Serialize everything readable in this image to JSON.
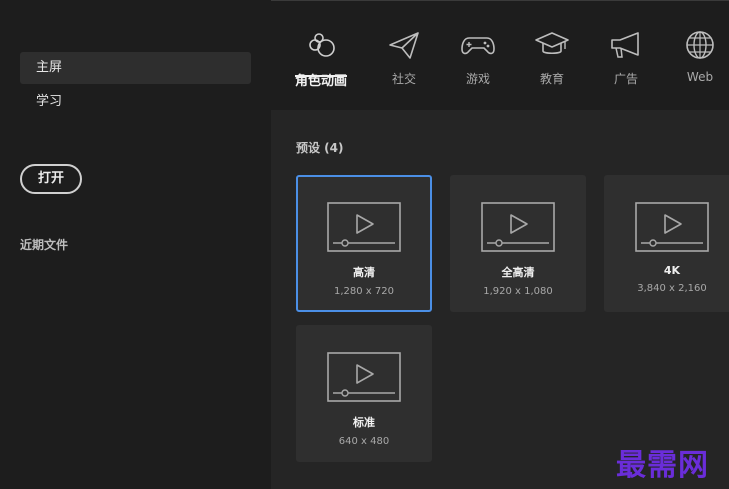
{
  "sidebar": {
    "items": [
      {
        "label": "主屏",
        "active": true
      },
      {
        "label": "学习",
        "active": false
      }
    ],
    "open_button": "打开",
    "recent_label": "近期文件"
  },
  "tabs": [
    {
      "label": "角色动画",
      "icon": "character-animation-icon",
      "active": true
    },
    {
      "label": "社交",
      "icon": "paper-plane-icon",
      "active": false
    },
    {
      "label": "游戏",
      "icon": "gamepad-icon",
      "active": false
    },
    {
      "label": "教育",
      "icon": "graduation-cap-icon",
      "active": false
    },
    {
      "label": "广告",
      "icon": "megaphone-icon",
      "active": false
    },
    {
      "label": "Web",
      "icon": "globe-icon",
      "active": false
    }
  ],
  "presets": {
    "title": "预设 (4)",
    "items": [
      {
        "name": "高清",
        "size": "1,280 x 720",
        "selected": true
      },
      {
        "name": "全高清",
        "size": "1,920 x 1,080",
        "selected": false
      },
      {
        "name": "4K",
        "size": "3,840 x 2,160",
        "selected": false
      },
      {
        "name": "标准",
        "size": "640 x 480",
        "selected": false
      }
    ]
  },
  "watermark": "最需网",
  "colors": {
    "accent": "#4b8fe6",
    "background": "#1d1d1d",
    "panel": "#252525",
    "card": "#2f2f2f",
    "watermark": "#6a2dd9"
  }
}
